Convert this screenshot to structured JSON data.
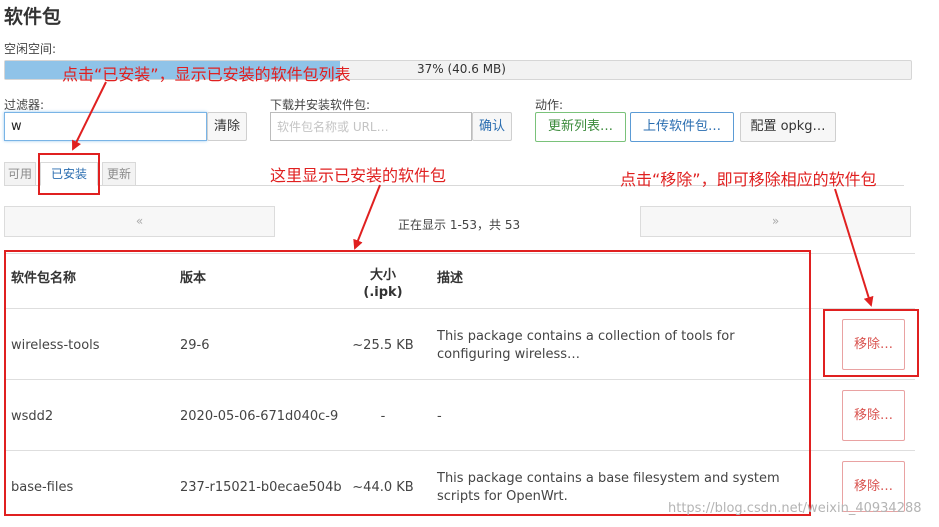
{
  "page": {
    "title": "软件包"
  },
  "storage": {
    "label": "空闲空间:",
    "percent": 37,
    "text": "37% (40.6 MB)"
  },
  "filter": {
    "label": "过滤器:",
    "value": "w",
    "clear_label": "清除"
  },
  "download": {
    "label": "下载并安装软件包:",
    "placeholder": "软件包名称或 URL…",
    "confirm_label": "确认"
  },
  "actions": {
    "label": "动作:",
    "update_lists": "更新列表…",
    "upload": "上传软件包…",
    "configure": "配置 opkg…"
  },
  "tabs": [
    {
      "label": "可用"
    },
    {
      "label": "已安装",
      "active": true
    },
    {
      "label": "更新"
    }
  ],
  "pagination": {
    "prev": "«",
    "next": "»",
    "status": "正在显示 1-53，共 53"
  },
  "table": {
    "headers": {
      "name": "软件包名称",
      "version": "版本",
      "size": "大小\n(.ipk)",
      "description": "描述"
    },
    "remove_label": "移除…",
    "rows": [
      {
        "name": "wireless-tools",
        "version": "29-6",
        "size": "~25.5 KB",
        "description": "This package contains a collection of tools for configuring wireless…"
      },
      {
        "name": "wsdd2",
        "version": "2020-05-06-671d040c-9",
        "size": "-",
        "description": "-"
      },
      {
        "name": "base-files",
        "version": "237-r15021-b0ecae504b",
        "size": "~44.0 KB",
        "description": "This package contains a base filesystem and system scripts for OpenWrt."
      }
    ]
  },
  "annotations": {
    "click_installed": "点击“已安装”，显示已安装的软件包列表",
    "installed_shown": "这里显示已安装的软件包",
    "click_remove": "点击“移除”，即可移除相应的软件包",
    "color": "#e02020"
  },
  "watermark": "https://blog.csdn.net/weixin_40934288"
}
